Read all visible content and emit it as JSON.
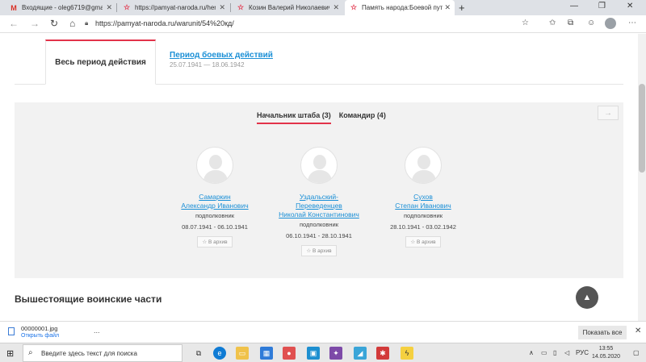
{
  "browser": {
    "tabs": [
      {
        "label": "Входящие - oleg6719@gmail.co",
        "icon": "gmail-icon",
        "active": false
      },
      {
        "label": "https://pamyat-naroda.ru/heroe",
        "icon": "star-favicon-icon",
        "active": false
      },
      {
        "label": "Козин Валерий Николаевич : П",
        "icon": "star-favicon-icon",
        "active": false
      },
      {
        "label": "Память народа:Боевой путь во",
        "icon": "star-favicon-icon",
        "active": true
      }
    ],
    "new_tab": "+",
    "url": "https://pamyat-naroda.ru/warunit/54%20кд/"
  },
  "page": {
    "period_tabs": {
      "all_label": "Весь период действия",
      "combat_label": "Период боевых действий",
      "combat_dates": "25.07.1941 — 18.06.1942"
    },
    "role_tabs": [
      {
        "label": "Начальник штаба (3)",
        "active": true
      },
      {
        "label": "Командир (4)",
        "active": false
      }
    ],
    "next_arrow": "→",
    "people": [
      {
        "name_lines": [
          "Самаркин",
          "Александр Иванович"
        ],
        "rank": "подполковник",
        "dates": "08.07.1941 - 06.10.1941",
        "archive_label": "В архив"
      },
      {
        "name_lines": [
          "Уздальский-",
          "Переведенцев",
          "Николай Константинович"
        ],
        "rank": "подполковник",
        "dates": "06.10.1941 - 28.10.1941",
        "archive_label": "В архив"
      },
      {
        "name_lines": [
          "Сухов",
          "Степан Иванович"
        ],
        "rank": "подполковник",
        "dates": "28.10.1941 - 03.02.1942",
        "archive_label": "В архив"
      }
    ],
    "section_title": "Вышестоящие воинские части",
    "scroll_top_icon": "chevron-up-icon"
  },
  "downloads": {
    "file_name": "00000001.jpg",
    "open_label": "Открыть файл",
    "more": "...",
    "show_all": "Показать все",
    "close": "✕"
  },
  "taskbar": {
    "search_placeholder": "Введите здесь текст для поиска",
    "language": "РУС",
    "time": "13:55",
    "date": "14.05.2020"
  },
  "colors": {
    "accent_red": "#e2334a",
    "link_blue": "#1a8fd6",
    "panel_bg": "#f2f2f2"
  }
}
